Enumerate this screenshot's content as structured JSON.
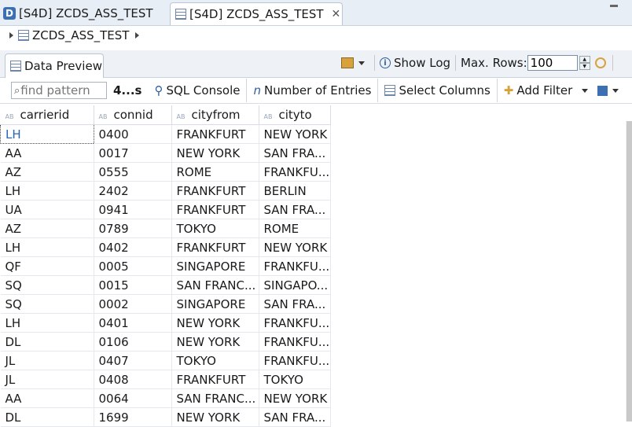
{
  "tabs": [
    {
      "label": "[S4D] ZCDS_ASS_TEST",
      "icon": "cds-document-icon"
    },
    {
      "label": "[S4D] ZCDS_ASS_TEST",
      "icon": "table-icon",
      "close": "✕"
    }
  ],
  "breadcrumb": {
    "label": "ZCDS_ASS_TEST"
  },
  "view_tab": {
    "label": "Data Preview"
  },
  "right_controls": {
    "show_log": "Show Log",
    "max_rows_label": "Max. Rows:",
    "max_rows_value": "100"
  },
  "toolbar": {
    "find_placeholder": "find pattern",
    "count": "4...s",
    "sql_console": "SQL Console",
    "number_of_entries": "Number of Entries",
    "select_columns": "Select Columns",
    "add_filter": "Add Filter"
  },
  "grid": {
    "columns": [
      "carrierid",
      "connid",
      "cityfrom",
      "cityto"
    ],
    "rows": [
      [
        "LH",
        "0400",
        "FRANKFURT",
        "NEW YORK"
      ],
      [
        "AA",
        "0017",
        "NEW YORK",
        "SAN FRA..."
      ],
      [
        "AZ",
        "0555",
        "ROME",
        "FRANKFU..."
      ],
      [
        "LH",
        "2402",
        "FRANKFURT",
        "BERLIN"
      ],
      [
        "UA",
        "0941",
        "FRANKFURT",
        "SAN FRA..."
      ],
      [
        "AZ",
        "0789",
        "TOKYO",
        "ROME"
      ],
      [
        "LH",
        "0402",
        "FRANKFURT",
        "NEW YORK"
      ],
      [
        "QF",
        "0005",
        "SINGAPORE",
        "FRANKFU..."
      ],
      [
        "SQ",
        "0015",
        "SAN FRANC...",
        "SINGAPO..."
      ],
      [
        "SQ",
        "0002",
        "SINGAPORE",
        "SAN FRA..."
      ],
      [
        "LH",
        "0401",
        "NEW YORK",
        "FRANKFU..."
      ],
      [
        "DL",
        "0106",
        "NEW YORK",
        "FRANKFU..."
      ],
      [
        "JL",
        "0407",
        "TOKYO",
        "FRANKFU..."
      ],
      [
        "JL",
        "0408",
        "FRANKFURT",
        "TOKYO"
      ],
      [
        "AA",
        "0064",
        "SAN FRANC...",
        "NEW YORK"
      ],
      [
        "DL",
        "1699",
        "NEW YORK",
        "SAN FRA..."
      ]
    ]
  },
  "colors": {
    "accent": "#2a63b8",
    "tab_bg": "#e8eef6"
  }
}
